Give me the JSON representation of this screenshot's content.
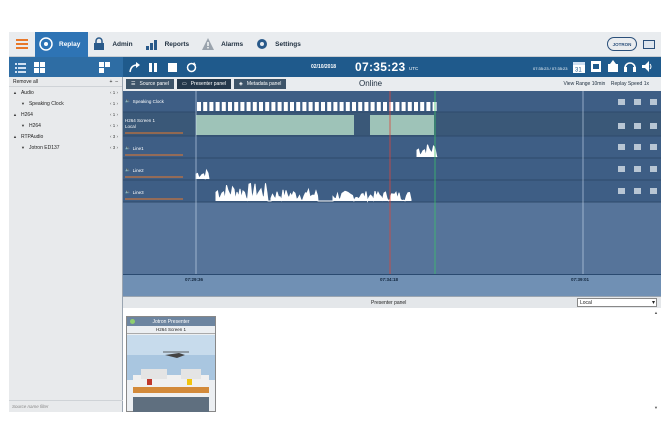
{
  "nav": {
    "items": [
      {
        "label": "Replay",
        "icon": "replay-icon",
        "active": true
      },
      {
        "label": "Admin",
        "icon": "lock-icon"
      },
      {
        "label": "Reports",
        "icon": "chart-icon"
      },
      {
        "label": "Alarms",
        "icon": "warning-icon"
      },
      {
        "label": "Settings",
        "icon": "gear-icon"
      }
    ],
    "logo_text": "JOTRON"
  },
  "toolbar": {
    "date": "02/10/2018",
    "time": "07:35:23",
    "tz": "UTC",
    "range_text": "07:35:23 / 07:35:23",
    "calendar_day": "31"
  },
  "sidebar": {
    "remove_all": "Remove all",
    "add": "+",
    "minus": "–",
    "tree": [
      {
        "label": "Audio",
        "indent": 0,
        "counter": "‹ 1 ›"
      },
      {
        "label": "Speaking Clock",
        "indent": 1,
        "counter": "‹ 1 ›"
      },
      {
        "label": "H264",
        "indent": 0,
        "counter": "‹ 1 ›"
      },
      {
        "label": "H264",
        "indent": 1,
        "counter": "‹ 1 ›"
      },
      {
        "label": "RTPAudio",
        "indent": 0,
        "counter": "‹ 3 ›"
      },
      {
        "label": "Jotron ED137",
        "indent": 1,
        "counter": "‹ 3 ›"
      }
    ],
    "filter_placeholder": "Source name filter"
  },
  "tabs": [
    {
      "label": "Source panel"
    },
    {
      "label": "Presenter panel",
      "active": true
    },
    {
      "label": "Metadata panel"
    }
  ],
  "status": "Online",
  "view_range": "View Range 10min",
  "replay_speed": "Replay Speed  1x",
  "tracks": [
    {
      "label": "Speaking Clock"
    },
    {
      "label": "H264 Screen 1",
      "sub": "Local"
    },
    {
      "label": "Line1"
    },
    {
      "label": "Line2"
    },
    {
      "label": "Line3"
    }
  ],
  "ruler": {
    "ticks": [
      "07:29:36",
      "07:34:18",
      "07:39:01"
    ]
  },
  "presenter": {
    "bar_title": "Presenter panel",
    "select_value": "Local",
    "card_title": "Jotron Presenter",
    "card_sub": "H264 Screen 1"
  },
  "colors": {
    "accent": "#2e74b5",
    "toolbar": "#1f5a8c",
    "track_bg": "#3e5e85",
    "video_fill": "#9ec3b8",
    "playhead_red": "#d9463b",
    "playhead_green": "#3cbf6a"
  }
}
